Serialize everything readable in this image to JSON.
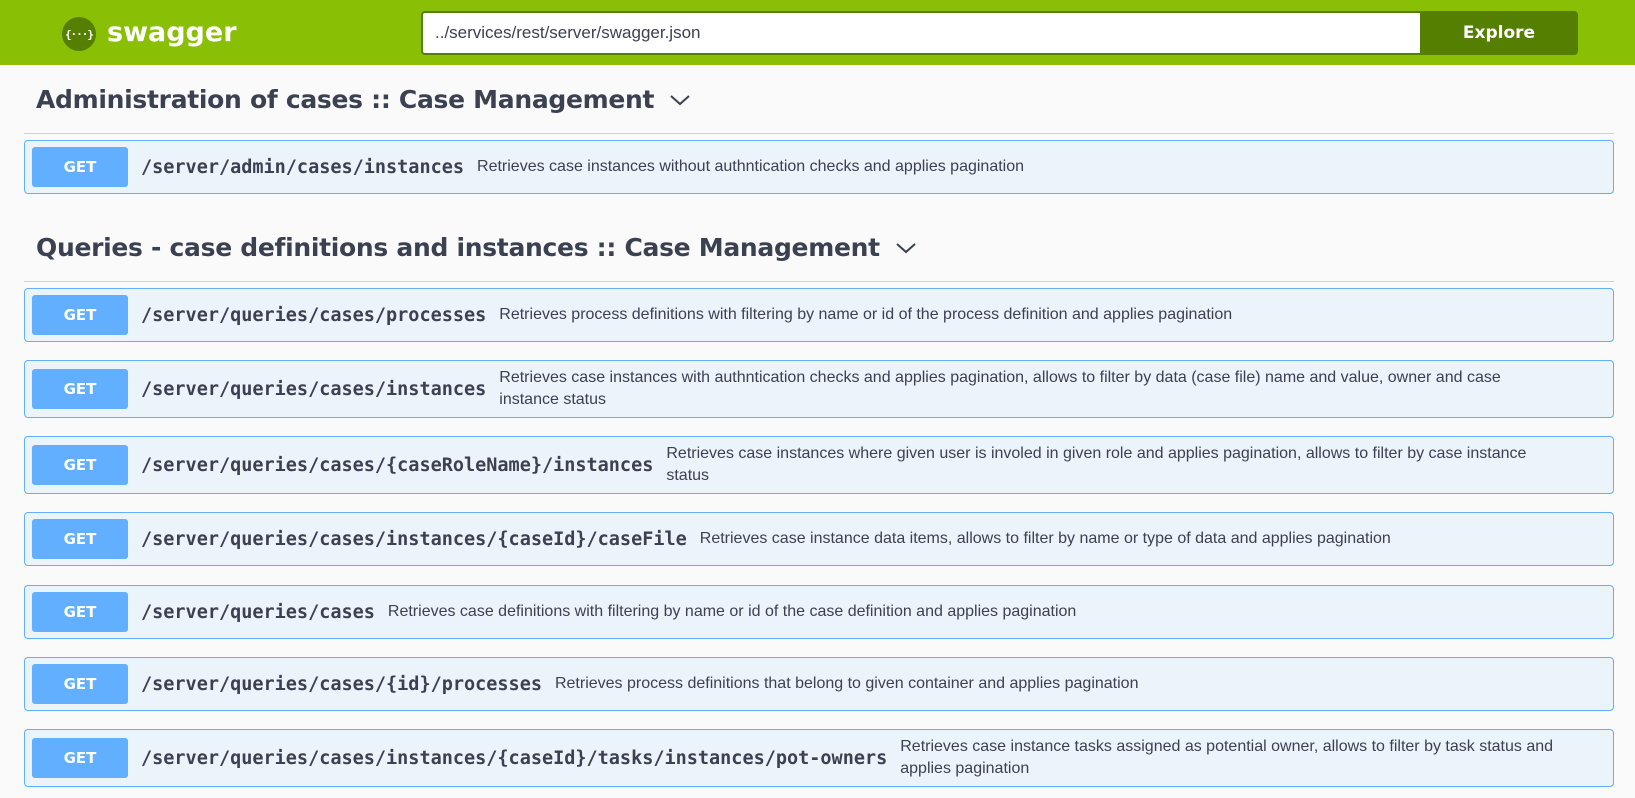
{
  "header": {
    "logo_glyph": "{···}",
    "logo_text": "swagger",
    "url_value": "../services/rest/server/swagger.json",
    "explore_label": "Explore",
    "colors": {
      "bar": "#89bf04",
      "dark": "#547f00"
    }
  },
  "sections": [
    {
      "title": "Administration of cases :: Case Management",
      "operations": [
        {
          "method": "GET",
          "path": "/server/admin/cases/instances",
          "description": "Retrieves case instances without authntication checks and applies pagination"
        }
      ]
    },
    {
      "title": "Queries - case definitions and instances :: Case Management",
      "operations": [
        {
          "method": "GET",
          "path": "/server/queries/cases/processes",
          "description": "Retrieves process definitions with filtering by name or id of the process definition and applies pagination"
        },
        {
          "method": "GET",
          "path": "/server/queries/cases/instances",
          "description": "Retrieves case instances with authntication checks and applies pagination, allows to filter by data (case file) name and value, owner and case instance status"
        },
        {
          "method": "GET",
          "path": "/server/queries/cases/{caseRoleName}/instances",
          "description": "Retrieves case instances where given user is involed in given role and applies pagination, allows to filter by case instance status"
        },
        {
          "method": "GET",
          "path": "/server/queries/cases/instances/{caseId}/caseFile",
          "description": "Retrieves case instance data items, allows to filter by name or type of data and applies pagination"
        },
        {
          "method": "GET",
          "path": "/server/queries/cases",
          "description": "Retrieves case definitions with filtering by name or id of the case definition and applies pagination"
        },
        {
          "method": "GET",
          "path": "/server/queries/cases/{id}/processes",
          "description": "Retrieves process definitions that belong to given container and applies pagination"
        },
        {
          "method": "GET",
          "path": "/server/queries/cases/instances/{caseId}/tasks/instances/pot-owners",
          "description": "Retrieves case instance tasks assigned as potential owner, allows to filter by task status and applies pagination"
        }
      ]
    }
  ],
  "method_color": "#61affe"
}
